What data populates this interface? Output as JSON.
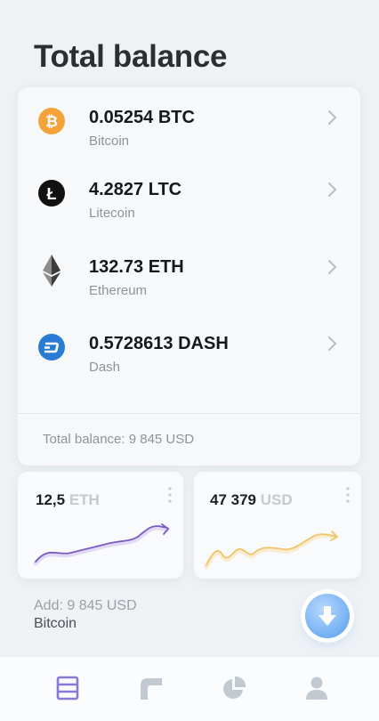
{
  "header": {
    "title": "Total balance"
  },
  "coins": [
    {
      "amount": "0.05254 BTC",
      "name": "Bitcoin",
      "icon": "bitcoin-icon"
    },
    {
      "amount": "4.2827 LTC",
      "name": "Litecoin",
      "icon": "litecoin-icon"
    },
    {
      "amount": "132.73 ETH",
      "name": "Ethereum",
      "icon": "ethereum-icon"
    },
    {
      "amount": "0.5728613 DASH",
      "name": "Dash",
      "icon": "dash-icon"
    }
  ],
  "summary": {
    "total_line": "Total balance: 9 845 USD"
  },
  "mini_cards": [
    {
      "value": "12,5",
      "unit": "ETH",
      "line_color": "#7b5cc4"
    },
    {
      "value": "47 379",
      "unit": "USD",
      "line_color": "#f0c46a"
    }
  ],
  "add": {
    "label": "Add: 9 845 USD",
    "coin": "Bitcoin"
  },
  "tabbar": {
    "items": [
      "list-icon",
      "corner-icon",
      "pie-chart-icon",
      "user-icon"
    ],
    "active_color": "#8a78d6",
    "inactive_color": "#c2c9d0"
  },
  "colors": {
    "btc": "#f4a33a",
    "ltc": "#111111",
    "eth": "#3c3c3d",
    "dash": "#2a7bd4",
    "fab": "#7cb5f5"
  }
}
